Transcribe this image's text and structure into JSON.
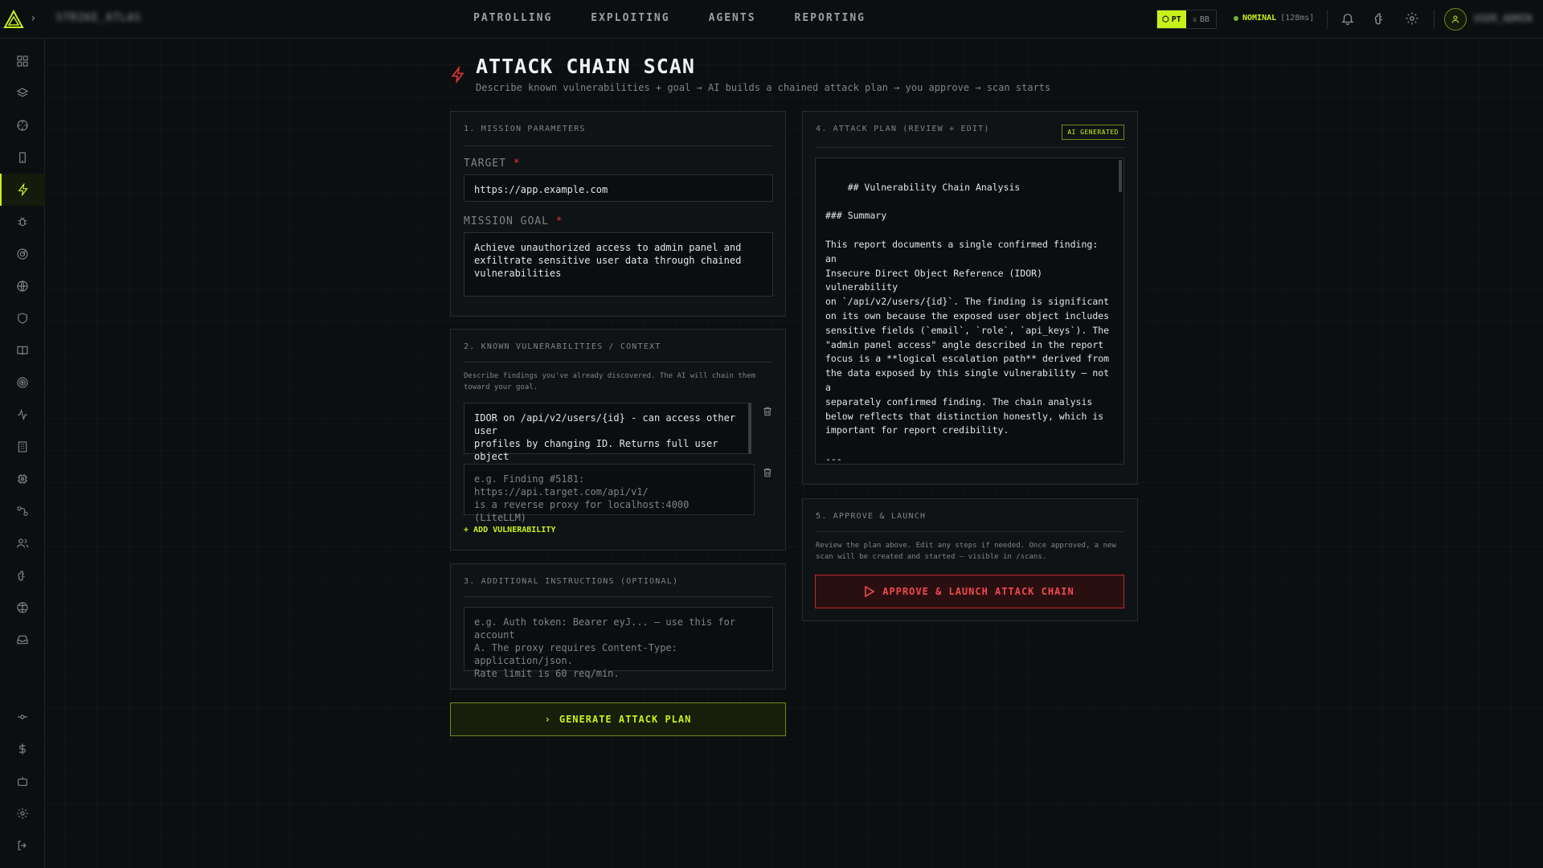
{
  "topbar": {
    "brand": "STRIKE_ATLAS",
    "nav": [
      "PATROLLING",
      "EXPLOITING",
      "AGENTS",
      "REPORTING"
    ],
    "mode_pt": "PT",
    "mode_bb": "BB",
    "status": "NOMINAL",
    "latency": "[128ms]",
    "user": "USER_ADMIN"
  },
  "sidebar": {
    "icons": [
      "dashboard-icon",
      "layers-icon",
      "crosshair-icon",
      "mobile-icon",
      "lightning-icon",
      "bug-icon",
      "radar-icon",
      "globe-icon",
      "shield-icon",
      "book-icon",
      "target-icon",
      "activity-icon",
      "building-icon",
      "chip-icon",
      "workflow-icon",
      "users-icon",
      "brain-icon",
      "network-icon",
      "inbox-icon"
    ],
    "bottom_icons": [
      "commit-icon",
      "dollar-icon",
      "bot-icon",
      "settings-icon",
      "logout-icon"
    ],
    "active": "lightning-icon"
  },
  "header": {
    "title": "ATTACK CHAIN SCAN",
    "subtitle": "Describe known vulnerabilities + goal → AI builds a chained attack plan → you approve → scan starts"
  },
  "mission": {
    "section": "1. MISSION PARAMETERS",
    "target_label": "TARGET",
    "target_value": "https://app.example.com",
    "goal_label": "MISSION GOAL",
    "goal_value": "Achieve unauthorized access to admin panel and\nexfiltrate sensitive user data through chained\nvulnerabilities",
    "required_mark": "*"
  },
  "vulns": {
    "section": "2. KNOWN VULNERABILITIES / CONTEXT",
    "hint": "Describe findings you've already discovered. The AI will chain them\ntoward your goal.",
    "items": [
      "IDOR on /api/v2/users/{id} - can access other user\nprofiles by changing ID. Returns full user object\nwith email, role, API keys."
    ],
    "placeholder": "e.g. Finding #5181: https://api.target.com/api/v1/\nis a reverse proxy for localhost:4000 (LiteLLM)",
    "add_label": "ADD VULNERABILITY"
  },
  "instructions": {
    "section": "3. ADDITIONAL INSTRUCTIONS (OPTIONAL)",
    "placeholder": "e.g. Auth token: Bearer eyJ... — use this for account\nA. The proxy requires Content-Type: application/json.\nRate limit is 60 req/min."
  },
  "generate_label": "GENERATE ATTACK PLAN",
  "plan": {
    "section": "4. ATTACK PLAN (REVIEW + EDIT)",
    "badge": "AI GENERATED",
    "content": "## Vulnerability Chain Analysis\n\n### Summary\n\nThis report documents a single confirmed finding: an\nInsecure Direct Object Reference (IDOR) vulnerability\non `/api/v2/users/{id}`. The finding is significant\non its own because the exposed user object includes\nsensitive fields (`email`, `role`, `api_keys`). The\n\"admin panel access\" angle described in the report\nfocus is a **logical escalation path** derived from\nthe data exposed by this single vulnerability — not a\nseparately confirmed finding. The chain analysis\nbelow reflects that distinction honestly, which is\nimportant for report credibility.\n\n---\n\nI want to flag something before writing the full\nstructured section."
  },
  "approve": {
    "section": "5. APPROVE & LAUNCH",
    "hint": "Review the plan above. Edit any steps if needed. Once approved, a new\nscan will be created and started — visible in /scans.",
    "button": "APPROVE & LAUNCH ATTACK CHAIN"
  },
  "colors": {
    "accent": "#c6f21a",
    "danger": "#e0353b",
    "background": "#0c0e10"
  }
}
